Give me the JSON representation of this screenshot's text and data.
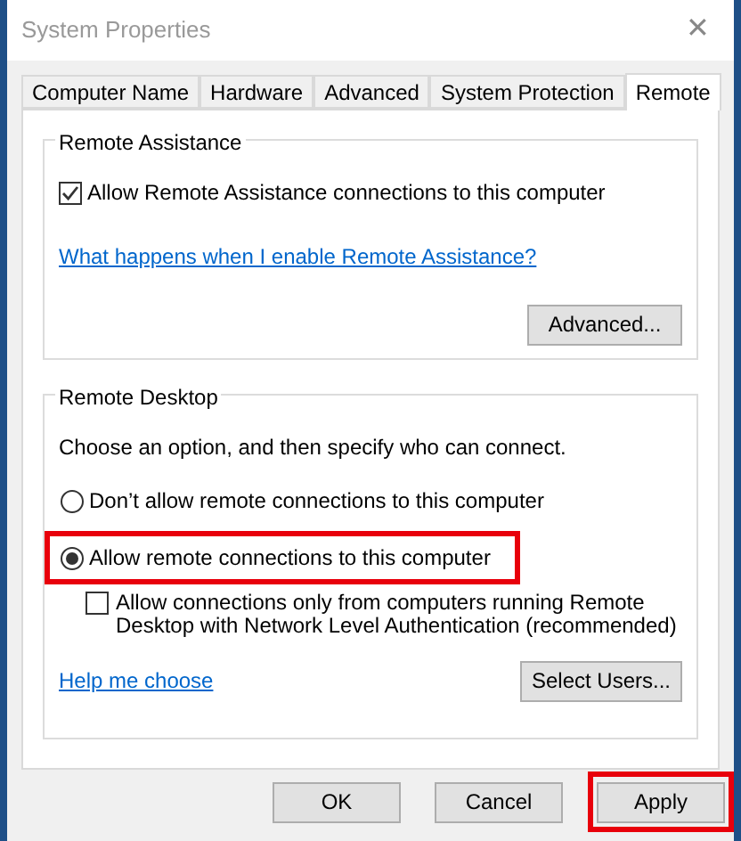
{
  "window": {
    "title": "System Properties",
    "close": "✕"
  },
  "tabs": [
    {
      "label": "Computer Name",
      "selected": false
    },
    {
      "label": "Hardware",
      "selected": false
    },
    {
      "label": "Advanced",
      "selected": false
    },
    {
      "label": "System Protection",
      "selected": false
    },
    {
      "label": "Remote",
      "selected": true
    }
  ],
  "remote_assistance": {
    "title": "Remote Assistance",
    "checkbox": {
      "label": "Allow Remote Assistance connections to this computer",
      "checked": true
    },
    "link": "What happens when I enable Remote Assistance?",
    "button": "Advanced..."
  },
  "remote_desktop": {
    "title": "Remote Desktop",
    "intro": "Choose an option, and then specify who can connect.",
    "options": [
      {
        "label": "Don’t allow remote connections to this computer",
        "selected": false,
        "highlighted": false
      },
      {
        "label": "Allow remote connections to this computer",
        "selected": true,
        "highlighted": true
      }
    ],
    "nla_checkbox": {
      "label": "Allow connections only from computers running Remote Desktop with Network Level Authentication (recommended)",
      "checked": false
    },
    "link": "Help me choose",
    "button": "Select Users..."
  },
  "buttons": [
    {
      "label": "OK",
      "highlighted": false
    },
    {
      "label": "Cancel",
      "highlighted": false
    },
    {
      "label": "Apply",
      "highlighted": true
    }
  ]
}
